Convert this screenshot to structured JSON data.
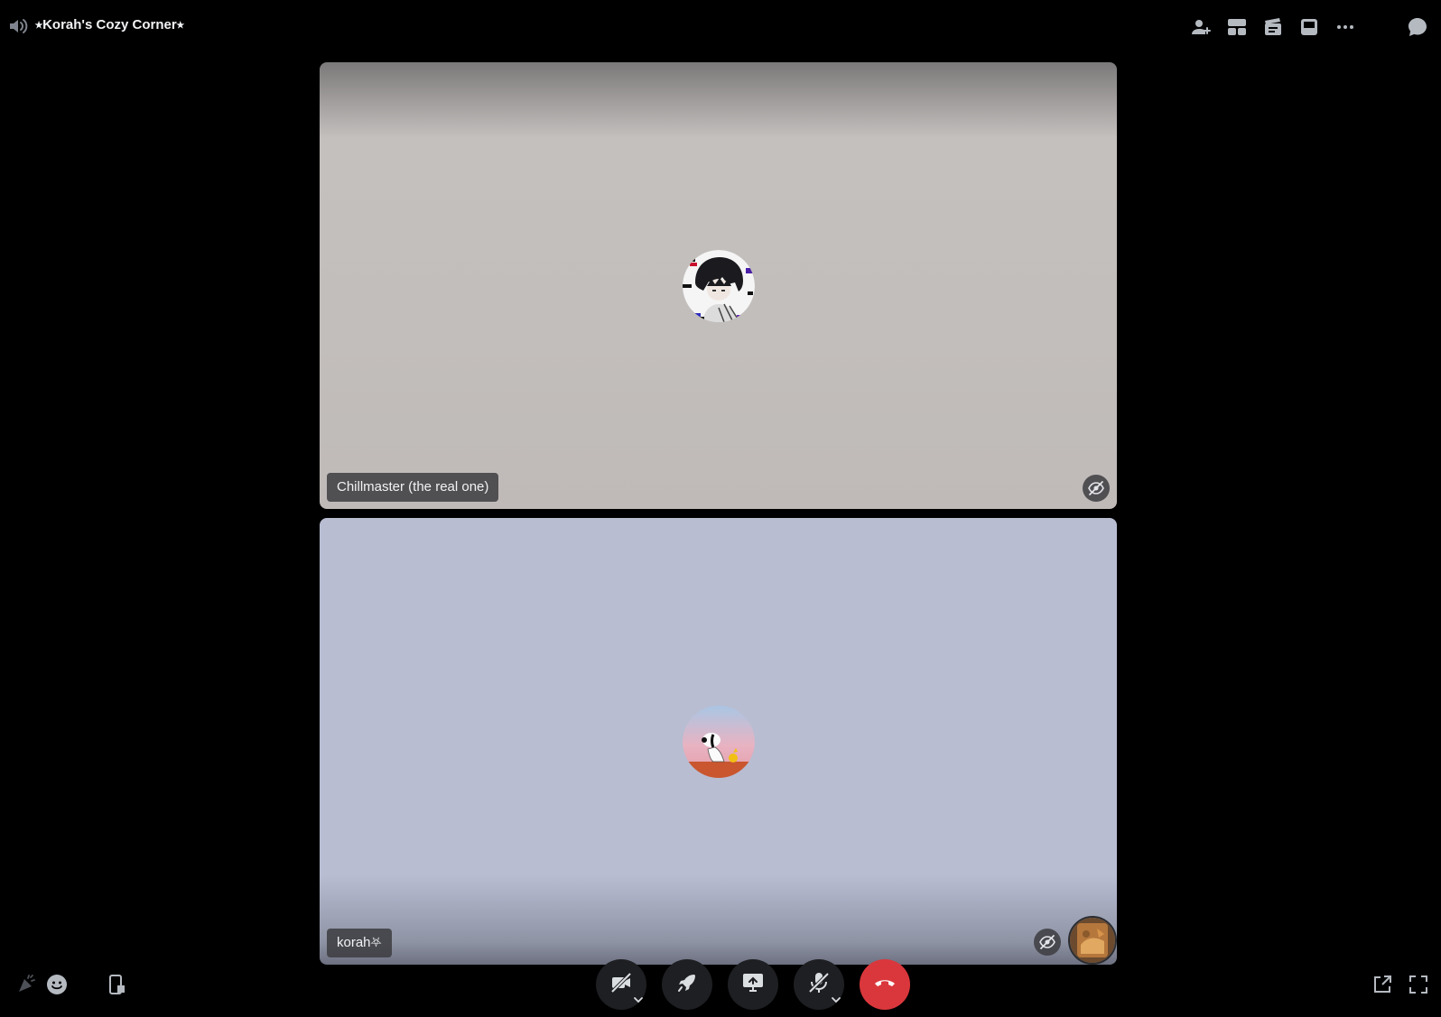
{
  "header": {
    "channel_title": "⭑Korah's Cozy Corner⭑",
    "channel_icon": "speaker-icon",
    "actions": [
      {
        "name": "invite-icon",
        "label": "Invite to Voice"
      },
      {
        "name": "grid-layout-icon",
        "label": "Change Layout"
      },
      {
        "name": "activities-icon",
        "label": "Start an Activity"
      },
      {
        "name": "inbox-icon",
        "label": "Inbox"
      },
      {
        "name": "more-icon",
        "label": "More"
      },
      {
        "name": "chat-icon",
        "label": "Show Chat"
      }
    ]
  },
  "participants": [
    {
      "name": "Chillmaster (the real one)",
      "avatar": "anime-boy-avatar",
      "status_icon": "stream-off-icon",
      "tile_color": "#c2bebc"
    },
    {
      "name": "korah⛧",
      "avatar": "snoopy-avatar",
      "status_icon": "stream-off-icon",
      "tile_color": "#b8bdd2",
      "self_preview": "self-avatar-thumbnail"
    }
  ],
  "controls": {
    "left": [
      {
        "name": "soundboard-icon"
      },
      {
        "name": "emoji-icon"
      },
      {
        "name": "mobile-handoff-icon"
      }
    ],
    "center": [
      {
        "name": "camera-off-icon",
        "has_menu": true
      },
      {
        "name": "activity-rocket-icon",
        "has_menu": false
      },
      {
        "name": "screen-share-icon",
        "has_menu": false
      },
      {
        "name": "mic-off-icon",
        "has_menu": true
      },
      {
        "name": "end-call-icon",
        "has_menu": false,
        "color": "#da373c"
      }
    ],
    "right": [
      {
        "name": "pop-out-icon"
      },
      {
        "name": "fullscreen-icon"
      }
    ]
  },
  "colors": {
    "background": "#000000",
    "control_bg": "#1e1f22",
    "danger": "#da373c"
  }
}
